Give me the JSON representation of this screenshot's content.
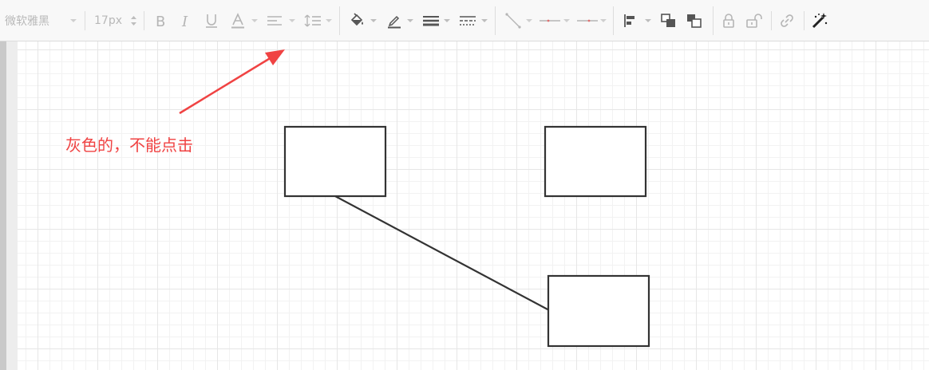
{
  "toolbar": {
    "font_family_value": "微软雅黑",
    "font_size_value": "17px",
    "tools": [
      "bold-icon",
      "italic-icon",
      "underline-icon",
      "font-color-icon",
      "align-icon",
      "line-spacing-icon",
      "fill-color-icon",
      "line-color-icon",
      "line-width-icon",
      "line-style-icon",
      "connector-line-icon",
      "line-start-icon",
      "line-end-icon",
      "arrange-icon",
      "bring-front-icon",
      "send-back-icon",
      "lock-icon",
      "unlock-icon",
      "link-icon",
      "magic-wand-icon"
    ],
    "disabled_color": "#b5b5b5",
    "active_color": "#555555"
  },
  "annotation": {
    "text": "灰色的，不能点击",
    "color": "#f04343"
  },
  "diagram": {
    "shape_stroke": "#333333",
    "shapes": [
      "rectangle",
      "rectangle",
      "rectangle"
    ],
    "connectors": [
      "straight-line"
    ]
  }
}
